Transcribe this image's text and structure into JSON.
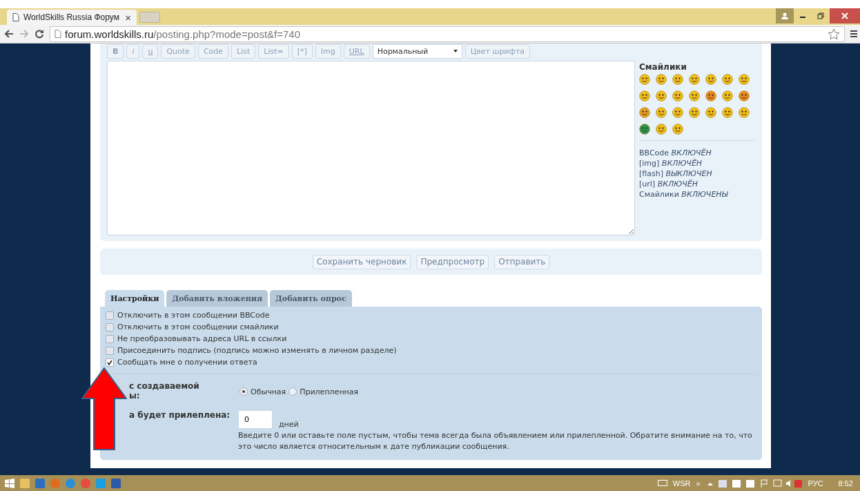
{
  "browser": {
    "tab_title": "WorldSkills Russia Форум",
    "tab_close": "×",
    "url_host": "forum.worldskills.ru",
    "url_path": "/posting.php?mode=post&f=740"
  },
  "editor": {
    "format_buttons": [
      {
        "label": "B",
        "kind": "bold"
      },
      {
        "label": "i",
        "kind": "italic"
      },
      {
        "label": "u",
        "kind": "underline"
      },
      {
        "label": "Quote",
        "kind": "plain"
      },
      {
        "label": "Code",
        "kind": "plain"
      },
      {
        "label": "List",
        "kind": "plain"
      },
      {
        "label": "List=",
        "kind": "plain"
      },
      {
        "label": "[*]",
        "kind": "plain"
      },
      {
        "label": "Img",
        "kind": "plain"
      },
      {
        "label": "URL",
        "kind": "underline"
      }
    ],
    "font_size": "Нормальный",
    "font_color_button": "Цвет шрифта"
  },
  "smilies": {
    "title": "Смайлики",
    "status": [
      {
        "name": "BBCode",
        "value": "ВКЛЮЧЁН"
      },
      {
        "name": "[img]",
        "value": "ВКЛЮЧЁН"
      },
      {
        "name": "[flash]",
        "value": "ВЫКЛЮЧЕН"
      },
      {
        "name": "[url]",
        "value": "ВКЛЮЧЁН"
      },
      {
        "name": "Смайлики",
        "value": "ВКЛЮЧЕНЫ"
      }
    ]
  },
  "actions": [
    "Сохранить черновик",
    "Предпросмотр",
    "Отправить"
  ],
  "tabs": [
    {
      "label": "Настройки",
      "selected": true
    },
    {
      "label": "Добавить вложения",
      "selected": false
    },
    {
      "label": "Добавить опрос",
      "selected": false
    }
  ],
  "options": [
    {
      "label": "Отключить в этом сообщении BBCode",
      "checked": false
    },
    {
      "label": "Отключить в этом сообщении смайлики",
      "checked": false
    },
    {
      "label": "Не преобразовывать адреса URL в ссылки",
      "checked": false
    },
    {
      "label": "Присоединить подпись (подпись можно изменять в личном разделе)",
      "checked": false
    },
    {
      "label": "Сообщать мне о получении ответа",
      "checked": true
    }
  ],
  "topic_type": {
    "label_lines": [
      "с создаваемой",
      "ы:"
    ],
    "options": [
      {
        "label": "Обычная",
        "selected": true
      },
      {
        "label": "Прилепленная",
        "selected": false
      }
    ]
  },
  "sticky": {
    "label": "а будет прилеплена:",
    "value": "0",
    "unit": "дней",
    "hint": "Введите 0 или оставьте поле пустым, чтобы тема всегда была объявлением или прилепленной. Обратите внимание на то, что это число является относительным к дате публикации сообщения."
  },
  "taskbar": {
    "tray_label": "WSR",
    "tray_more": "»",
    "language": "РУС",
    "time": "8:52"
  }
}
